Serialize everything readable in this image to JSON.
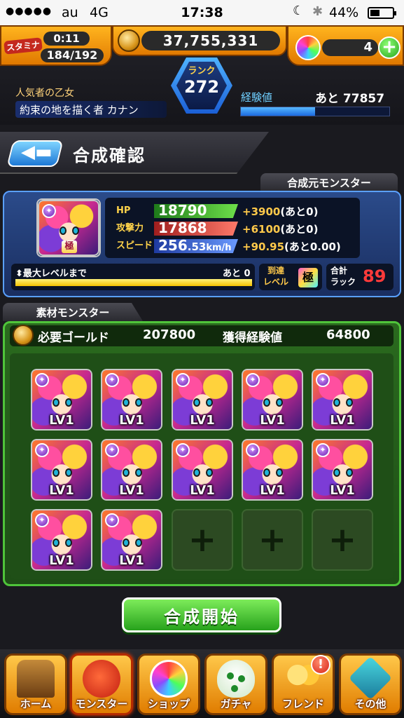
{
  "status_bar": {
    "signal_dots": "●●●●●",
    "carrier": "au",
    "network": "4G",
    "time": "17:38",
    "battery": "44%",
    "battery_level": 0.44
  },
  "header": {
    "stamina_label": "スタミナ",
    "stamina_timer": "0:11",
    "stamina_value": "184/192",
    "gold": "37,755,331",
    "orb_count": "4",
    "plus_label": "+",
    "rank_label": "ランク",
    "rank_value": "272",
    "title_small": "人気者の乙女",
    "title_name": "約束の地を描く者 カナン",
    "exp_label": "経験値",
    "exp_remaining": "あと 77857",
    "exp_progress": 0.5
  },
  "page": {
    "back_icon": "back-arrow-icon",
    "title": "合成確認"
  },
  "base_monster": {
    "section_label": "合成元モンスター",
    "hp_label": "HP",
    "hp_value": "18790",
    "hp_bonus": "+3900",
    "hp_rest": "(あと0)",
    "atk_label": "攻撃力",
    "atk_value": "17868",
    "atk_bonus": "+6100",
    "atk_rest": "(あと0)",
    "spd_label": "スピード",
    "spd_value": "256",
    "spd_frac": ".53",
    "spd_unit": "km/h",
    "spd_bonus": "+90.95",
    "spd_rest": "(あと0.00)",
    "level_label": "最大レベルまで",
    "level_remaining": "あと 0",
    "level_progress": 1.0,
    "reach_label_1": "到達",
    "reach_label_2": "レベル",
    "reach_badge": "極",
    "luck_label_1": "合計",
    "luck_label_2": "ラック",
    "luck_value": "89"
  },
  "material": {
    "section_label": "素材モンスター",
    "gold_label": "必要ゴールド",
    "gold_value": "207800",
    "exp_label": "獲得経験値",
    "exp_value": "64800",
    "lv_text": "LV1",
    "empty_plus": "+",
    "filled_slots": 12,
    "empty_slots": 3
  },
  "start_button": "合成開始",
  "nav": {
    "home": "ホーム",
    "monster": "モンスター",
    "shop": "ショップ",
    "gacha": "ガチャ",
    "friend": "フレンド",
    "other": "その他",
    "friend_alert": "!"
  },
  "colors": {
    "accent_orange": "#ffb41e",
    "panel_blue": "#2b4b8a",
    "panel_green": "#2a6a1e",
    "start_green": "#27a21c",
    "luck_red": "#ff3a3a"
  }
}
